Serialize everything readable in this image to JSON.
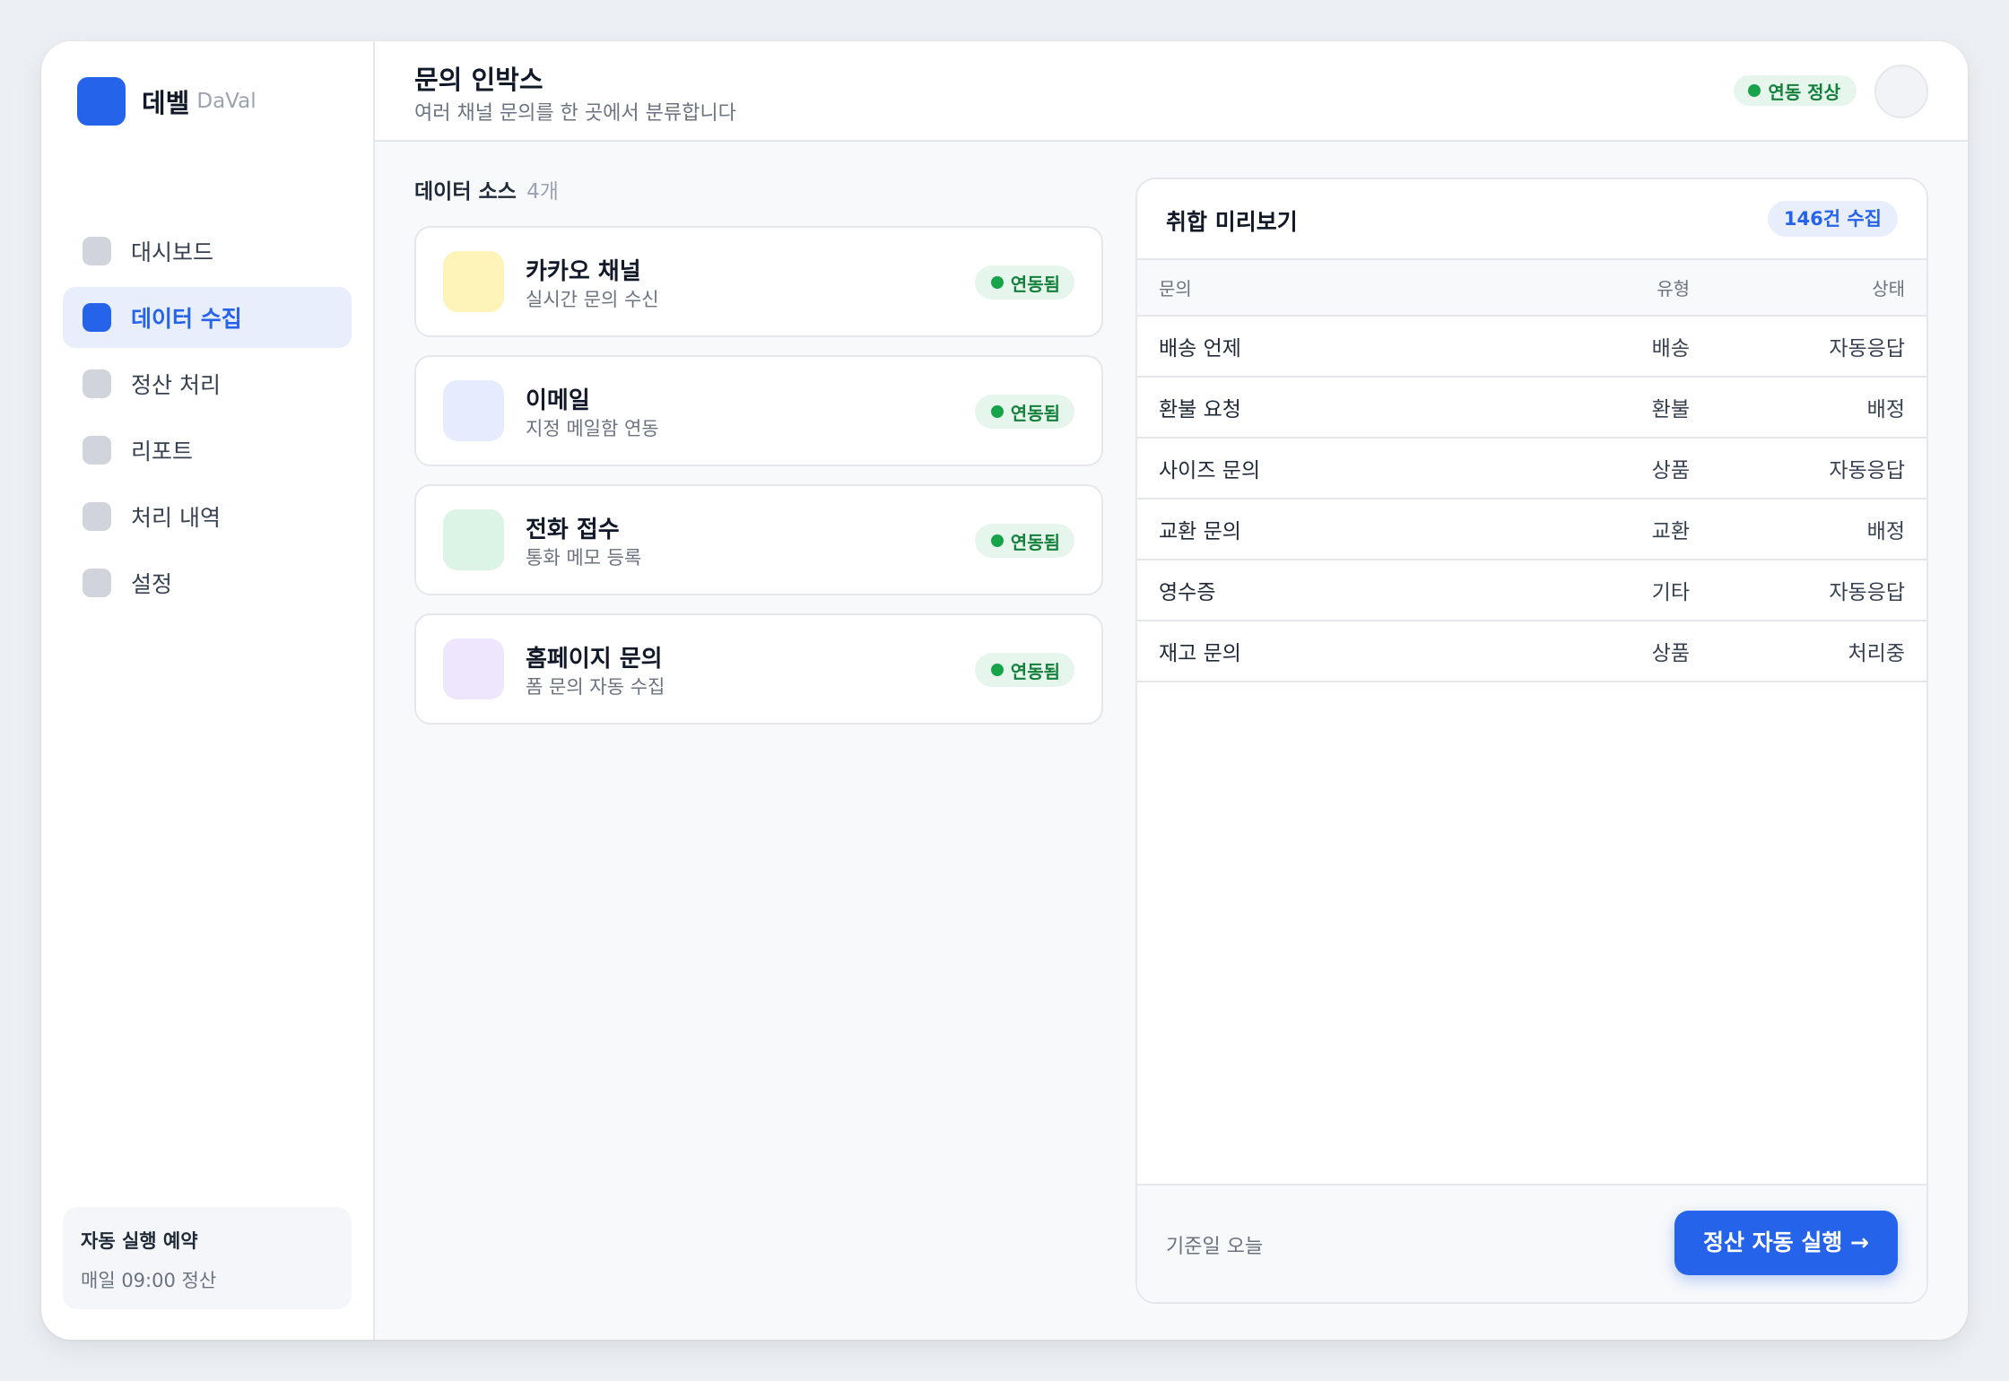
{
  "brand": {
    "name": "데벨",
    "sub": "DaVal",
    "logo_color": "#2563eb"
  },
  "sidebar": {
    "items": [
      {
        "label": "대시보드",
        "active": false
      },
      {
        "label": "데이터 수집",
        "active": true
      },
      {
        "label": "정산 처리",
        "active": false
      },
      {
        "label": "리포트",
        "active": false
      },
      {
        "label": "처리 내역",
        "active": false
      },
      {
        "label": "설정",
        "active": false
      }
    ],
    "schedule": {
      "title": "자동 실행 예약",
      "sub": "매일 09:00 정산"
    }
  },
  "header": {
    "title": "문의 인박스",
    "subtitle": "여러 채널 문의를 한 곳에서 분류합니다",
    "status": "연동 정상"
  },
  "sources": {
    "title": "데이터 소스",
    "count": "4개",
    "items": [
      {
        "name": "카카오 채널",
        "desc": "실시간 문의 수신",
        "badge": "연동됨",
        "icon_color": "#fef3b8"
      },
      {
        "name": "이메일",
        "desc": "지정 메일함 연동",
        "badge": "연동됨",
        "icon_color": "#e5ecfd"
      },
      {
        "name": "전화 접수",
        "desc": "통화 메모 등록",
        "badge": "연동됨",
        "icon_color": "#dcf4e6"
      },
      {
        "name": "홈페이지 문의",
        "desc": "폼 문의 자동 수집",
        "badge": "연동됨",
        "icon_color": "#ede6fc"
      }
    ]
  },
  "preview": {
    "title": "취합 미리보기",
    "count": "146건 수집",
    "columns": [
      "문의",
      "유형",
      "상태"
    ],
    "rows": [
      [
        "배송 언제",
        "배송",
        "자동응답"
      ],
      [
        "환불 요청",
        "환불",
        "배정"
      ],
      [
        "사이즈 문의",
        "상품",
        "자동응답"
      ],
      [
        "교환 문의",
        "교환",
        "배정"
      ],
      [
        "영수증",
        "기타",
        "자동응답"
      ],
      [
        "재고 문의",
        "상품",
        "처리중"
      ]
    ],
    "footer_text": "기준일 오늘",
    "run_button": "정산 자동 실행 →"
  },
  "colors": {
    "accent": "#2563eb",
    "success": "#16a34a"
  }
}
